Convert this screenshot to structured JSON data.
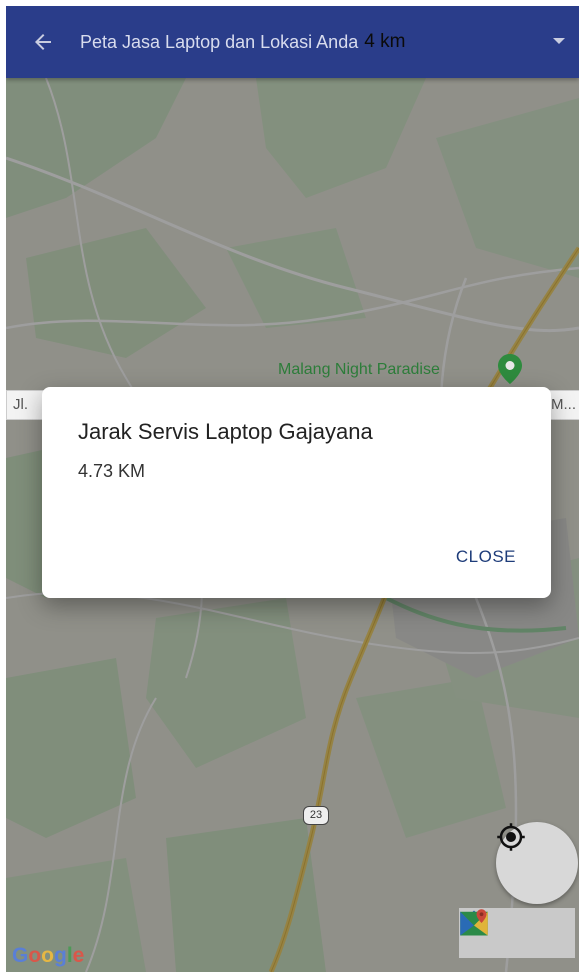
{
  "appbar": {
    "title": "Peta Jasa Laptop dan Lokasi Anda",
    "distance_selected": "4 km"
  },
  "map": {
    "poi_label": "Malang Night Paradise",
    "street_label_left": "Jl. ",
    "street_label_right": "M...",
    "route_shield": "23",
    "attribution": [
      "G",
      "o",
      "o",
      "g",
      "l",
      "e"
    ]
  },
  "dialog": {
    "title": "Jarak Servis Laptop Gajayana",
    "distance": "4.73 KM",
    "close_label": "CLOSE"
  },
  "colors": {
    "appbar": "#2a3d8a",
    "dialog_action": "#1e3c7a",
    "poi": "#2d7d3a"
  }
}
